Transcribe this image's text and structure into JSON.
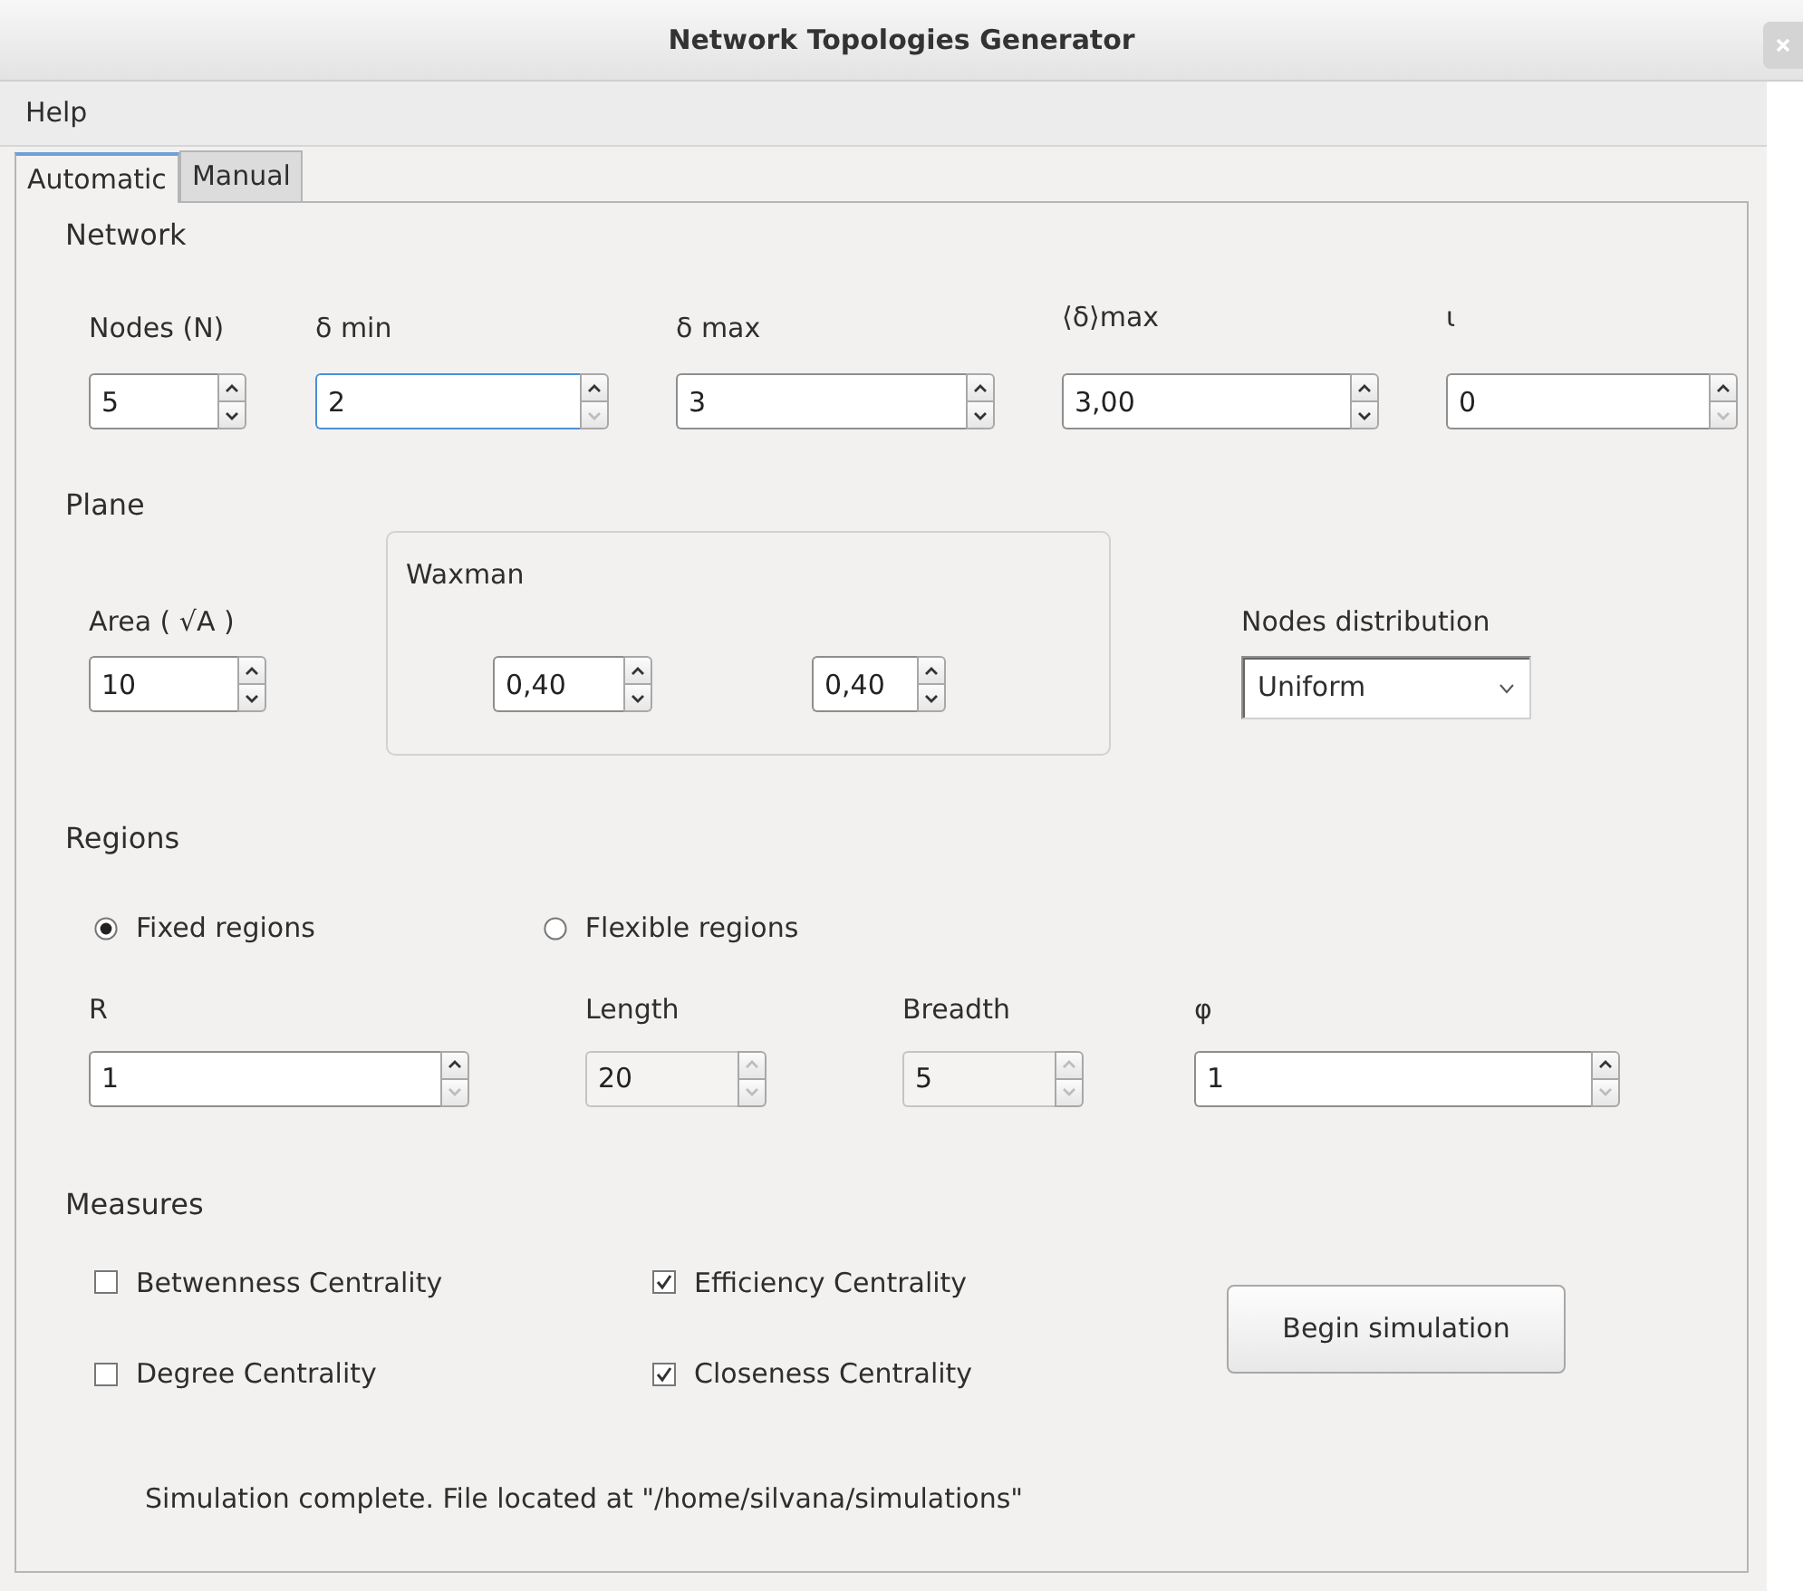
{
  "window": {
    "title": "Network Topologies Generator"
  },
  "menu": [
    {
      "label": "Help"
    }
  ],
  "tabs": [
    {
      "label": "Automatic",
      "selected": true
    },
    {
      "label": "Manual",
      "selected": false
    }
  ],
  "network": {
    "title": "Network",
    "fields": [
      {
        "label": "Nodes (N)",
        "value": "5",
        "disabled": false,
        "focused": false,
        "up_enabled": true,
        "down_enabled": true
      },
      {
        "label": "δ min",
        "value": "2",
        "disabled": false,
        "focused": true,
        "up_enabled": true,
        "down_enabled": false
      },
      {
        "label": "δ max",
        "value": "3",
        "disabled": false,
        "focused": false,
        "up_enabled": true,
        "down_enabled": true
      },
      {
        "label": "⟨δ⟩max",
        "value": "3,00",
        "disabled": false,
        "focused": false,
        "up_enabled": true,
        "down_enabled": true
      },
      {
        "label": "ι",
        "value": "0",
        "disabled": false,
        "focused": false,
        "up_enabled": true,
        "down_enabled": false
      }
    ]
  },
  "plane": {
    "title": "Plane",
    "area": {
      "label": "Area ( √A )",
      "value": "10",
      "disabled": false,
      "focused": false,
      "up_enabled": true,
      "down_enabled": true
    },
    "waxman": {
      "title": "Waxman",
      "fields": [
        {
          "value": "0,40",
          "disabled": false,
          "focused": false,
          "up_enabled": true,
          "down_enabled": true
        },
        {
          "value": "0,40",
          "disabled": false,
          "focused": false,
          "up_enabled": true,
          "down_enabled": true
        }
      ]
    },
    "distribution": {
      "label": "Nodes distribution",
      "value": "Uniform"
    }
  },
  "regions": {
    "title": "Regions",
    "options": [
      {
        "label": "Fixed regions",
        "selected": true
      },
      {
        "label": "Flexible regions",
        "selected": false
      }
    ],
    "fields": [
      {
        "label": "R",
        "value": "1",
        "disabled": false,
        "focused": false,
        "up_enabled": true,
        "down_enabled": false
      },
      {
        "label": "Length",
        "value": "20",
        "disabled": true,
        "focused": false,
        "up_enabled": false,
        "down_enabled": false
      },
      {
        "label": "Breadth",
        "value": "5",
        "disabled": true,
        "focused": false,
        "up_enabled": false,
        "down_enabled": false
      },
      {
        "label": "φ",
        "value": "1",
        "disabled": false,
        "focused": false,
        "up_enabled": true,
        "down_enabled": false
      }
    ]
  },
  "measures": {
    "title": "Measures",
    "checks": [
      {
        "label": "Betwenness Centrality",
        "checked": false
      },
      {
        "label": "Efficiency Centrality",
        "checked": true
      },
      {
        "label": "Degree Centrality",
        "checked": false
      },
      {
        "label": "Closeness Centrality",
        "checked": true
      }
    ],
    "button": "Begin simulation"
  },
  "status": "Simulation complete. File located at \"/home/silvana/simulations\""
}
